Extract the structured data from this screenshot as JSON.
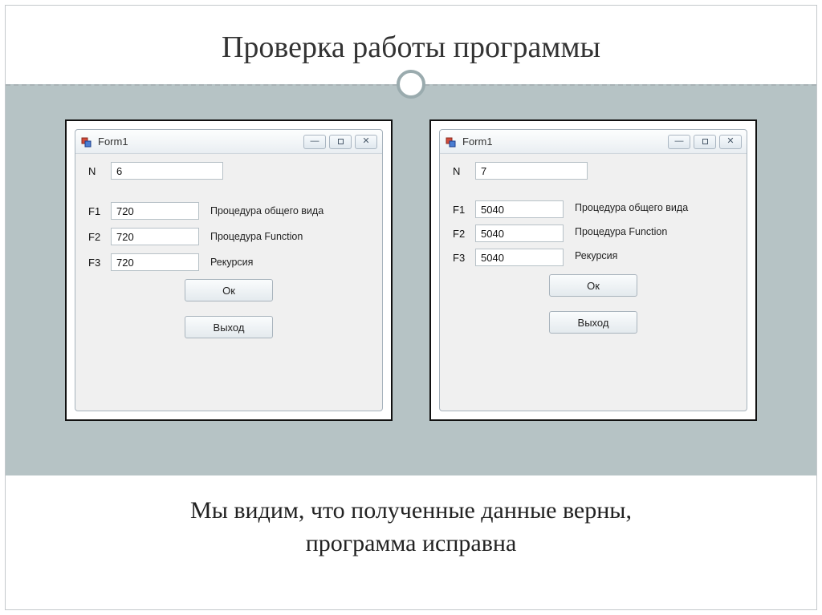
{
  "slide": {
    "title": "Проверка работы программы",
    "caption_line1": "Мы видим, что полученные данные верны,",
    "caption_line2": "программа исправна"
  },
  "win1": {
    "title": "Form1",
    "n_label": "N",
    "n_value": "6",
    "f1_label": "F1",
    "f1_value": "720",
    "f1_side": "Процедура общего вида",
    "f2_label": "F2",
    "f2_value": "720",
    "f2_side": "Процедура Function",
    "f3_label": "F3",
    "f3_value": "720",
    "f3_side": "Рекурсия",
    "ok_label": "Ок",
    "exit_label": "Выход"
  },
  "win2": {
    "title": "Form1",
    "n_label": "N",
    "n_value": "7",
    "f1_label": "F1",
    "f1_value": "5040",
    "f1_side": "Процедура общего вида",
    "f2_label": "F2",
    "f2_value": "5040",
    "f2_side": "Процедура Function",
    "f3_label": "F3",
    "f3_value": "5040",
    "f3_side": "Рекурсия",
    "ok_label": "Ок",
    "exit_label": "Выход"
  },
  "icons": {
    "form": "form-icon",
    "min": "minimize-icon",
    "max": "maximize-icon",
    "close": "close-icon"
  }
}
